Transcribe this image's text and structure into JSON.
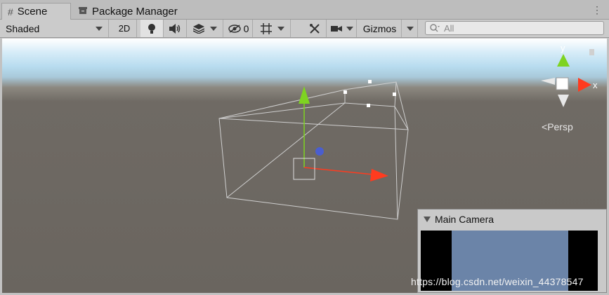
{
  "tabs": [
    {
      "label": "Scene",
      "icon": "grid-icon",
      "active": true
    },
    {
      "label": "Package Manager",
      "icon": "package-icon",
      "active": false
    }
  ],
  "toolbar": {
    "draw_mode": "Shaded",
    "mode_2d": "2D",
    "hidden_count": "0",
    "gizmos_label": "Gizmos",
    "search_placeholder": "All"
  },
  "viewport": {
    "persp_label": "Persp",
    "axis_y": "y",
    "axis_x": "x"
  },
  "camera_preview": {
    "title": "Main Camera"
  },
  "watermark": "https://blog.csdn.net/weixin_44378547",
  "colors": {
    "y_axis": "#7ed321",
    "x_axis": "#ff3b1f",
    "z_handle": "#4a5ecf",
    "camera_bg": "#6b84a8"
  }
}
